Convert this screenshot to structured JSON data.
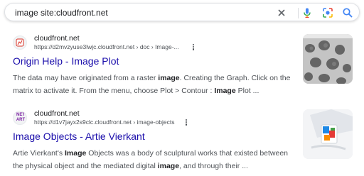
{
  "search": {
    "query": "image site:cloudfront.net",
    "icons": [
      "close-icon",
      "microphone-icon",
      "camera-lens-icon",
      "search-icon"
    ]
  },
  "colors": {
    "link": "#1a0dab",
    "url": "#4d5156",
    "text": "#202124"
  },
  "results": [
    {
      "site_name": "cloudfront.net",
      "url": "https://d2mvzyuse3lwjc.cloudfront.net › doc › Image-...",
      "title": "Origin Help - Image Plot",
      "snippet": [
        {
          "t": "The data may have originated from a raster ",
          "b": false
        },
        {
          "t": "image",
          "b": true
        },
        {
          "t": ". Creating the Graph. Click on the matrix to activate it. From the menu, choose Plot > Contour : ",
          "b": false
        },
        {
          "t": "Image",
          "b": true
        },
        {
          "t": " Plot ...",
          "b": false
        }
      ],
      "favicon": "origin-logo-icon"
    },
    {
      "site_name": "cloudfront.net",
      "url": "https://d1v7jayx2s9clc.cloudfront.net › image-objects",
      "title": "Image Objects - Artie Vierkant",
      "snippet": [
        {
          "t": "Artie Vierkant's ",
          "b": false
        },
        {
          "t": "Image",
          "b": true
        },
        {
          "t": " Objects was a body of sculptural works that existed between the physical object and the mediated digital ",
          "b": false
        },
        {
          "t": "image",
          "b": true
        },
        {
          "t": ", and through their ...",
          "b": false
        }
      ],
      "favicon_text": "NET ART"
    }
  ]
}
